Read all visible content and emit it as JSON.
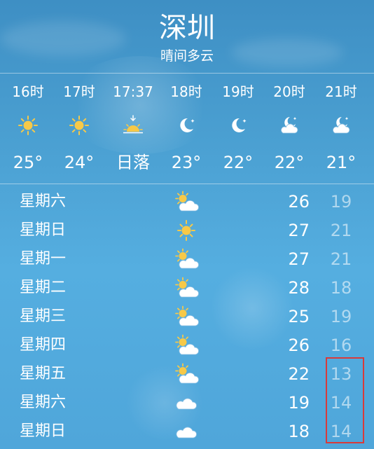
{
  "header": {
    "city": "深圳",
    "condition": "晴间多云"
  },
  "hourly": [
    {
      "time": "16时",
      "icon": "sun-icon",
      "temp": "25°"
    },
    {
      "time": "17时",
      "icon": "sun-icon",
      "temp": "24°"
    },
    {
      "time": "17:37",
      "icon": "sunset-icon",
      "temp": "日落"
    },
    {
      "time": "18时",
      "icon": "moon-icon",
      "temp": "23°"
    },
    {
      "time": "19时",
      "icon": "moon-icon",
      "temp": "22°"
    },
    {
      "time": "20时",
      "icon": "moon-cloud-icon",
      "temp": "22°"
    },
    {
      "time": "21时",
      "icon": "moon-cloud-icon",
      "temp": "21°"
    }
  ],
  "daily": [
    {
      "day": "星期六",
      "icon": "partly-cloudy-icon",
      "high": "26",
      "low": "19"
    },
    {
      "day": "星期日",
      "icon": "sun-icon",
      "high": "27",
      "low": "21"
    },
    {
      "day": "星期一",
      "icon": "partly-cloudy-icon",
      "high": "27",
      "low": "21"
    },
    {
      "day": "星期二",
      "icon": "partly-cloudy-icon",
      "high": "28",
      "low": "18"
    },
    {
      "day": "星期三",
      "icon": "partly-cloudy-icon",
      "high": "25",
      "low": "19"
    },
    {
      "day": "星期四",
      "icon": "partly-cloudy-icon",
      "high": "26",
      "low": "16"
    },
    {
      "day": "星期五",
      "icon": "partly-cloudy-icon",
      "high": "22",
      "low": "13"
    },
    {
      "day": "星期六",
      "icon": "cloud-icon",
      "high": "19",
      "low": "14"
    },
    {
      "day": "星期日",
      "icon": "cloud-icon",
      "high": "18",
      "low": "14"
    }
  ],
  "colors": {
    "sun": "#f7c948",
    "highlight_box": "#d93a3a"
  }
}
